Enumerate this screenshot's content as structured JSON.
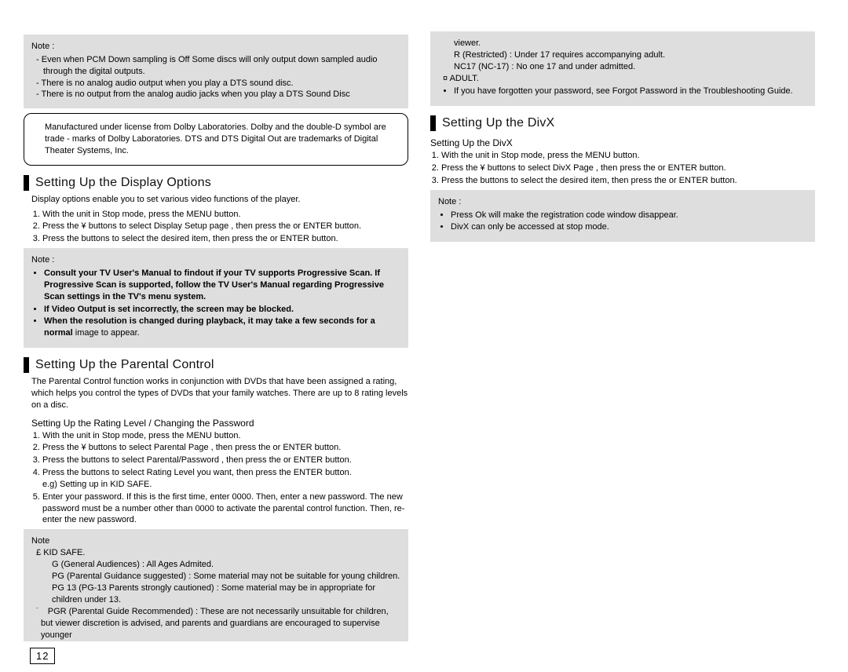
{
  "pcm_note": {
    "label": "Note :",
    "items": [
      "Even when PCM Down sampling is Off Some discs will only output down sampled audio through the digital outputs.",
      "There is no analog audio output when you play a DTS sound disc.",
      "There is no output from the analog audio jacks when you play a DTS Sound Disc"
    ]
  },
  "license_box": "Manufactured under license from Dolby Laboratories.  Dolby  and the double-D symbol are trade   - marks of Dolby Laboratories.  DTS  and  DTS Digital Out  are trademarks of Digital Theater Systems, Inc.",
  "display": {
    "title": "Setting Up the Display Options",
    "intro": "Display options enable you to set various video functions of the player.",
    "steps": [
      "With the unit in Stop mode, press the  MENU  button.",
      "Press the  ¥        buttons to select  Display Setup page , then press the       or ENTER button.",
      "Press the              buttons to select the desired item, then press the        or ENTER button."
    ],
    "note_label": "Note :",
    "notes": [
      "Consult your TV User's Manual to findout if your TV supports Progressive Scan. If Progressive Scan is supported, follow the TV User's Manual regarding Progressive Scan settings in the TV's menu system.",
      "If Video Output is set incorrectly, the screen may be blocked.",
      "When the resolution is changed during playback, it may take a few seconds for a normal"
    ],
    "note_tail": "image to appear."
  },
  "parental": {
    "title": "Setting Up the Parental Control",
    "intro": "The Parental Control function works in conjunction with DVDs that have been assigned a rating, which helps you control the types of DVDs that your family watches. There are up to 8 rating levels on a disc.",
    "subhdr": "Setting Up the Rating Level / Changing the Password",
    "steps": [
      "With the unit in Stop mode, press the  MENU  button.",
      "Press the  ¥        buttons to select  Parental Page , then press the       or ENTER button.",
      "Press the              buttons to select  Parental/Password  , then press the       or ENTER button.",
      "Press the              buttons to select  Rating Level  you want, then press the  ENTER button.\ne.g) Setting up in KID SAFE.",
      "Enter your password. If this is the first time, enter 0000. Then, enter a new password. The new password must be a number other than 0000 to activate the parental control function. Then, re-enter the new password."
    ],
    "note_label": "Note",
    "ratings_first_bullet": "£",
    "ratings": [
      "KID SAFE.",
      "G (General Audiences) : All Ages Admited.",
      "PG (Parental Guidance suggested) : Some material may not be suitable for young children.",
      "PG 13 (PG-13 Parents strongly cautioned) : Some material may be in appropriate for children under 13.",
      "PGR (Parental Guide Recommended) : These are not necessarily unsuitable for children, but viewer discretion is advised, and parents and guardians are encouraged to supervise younger"
    ],
    "ratings_cont": [
      "viewer.",
      "R (Restricted) : Under 17 requires accompanying adult.",
      "NC17 (NC-17) : No one 17 and under admitted."
    ],
    "adult_bullet": "¤ ADULT.",
    "forgot": "If you have forgotten your password, see  Forgot Password  in the Troubleshooting Guide."
  },
  "divx": {
    "title": "Setting Up the DivX",
    "subhdr": "Setting Up the DivX",
    "steps": [
      "With the unit in Stop mode, press the  MENU  button.",
      "Press the  ¥        buttons to select  DivX Page , then press the       or ENTER button.",
      "Press the              buttons to select the desired item, then press the        or ENTER button."
    ],
    "note_label": "Note :",
    "notes": [
      "Press Ok will make the registration code window disappear.",
      "DivX can only be accessed at stop mode."
    ]
  },
  "page_number": "12"
}
